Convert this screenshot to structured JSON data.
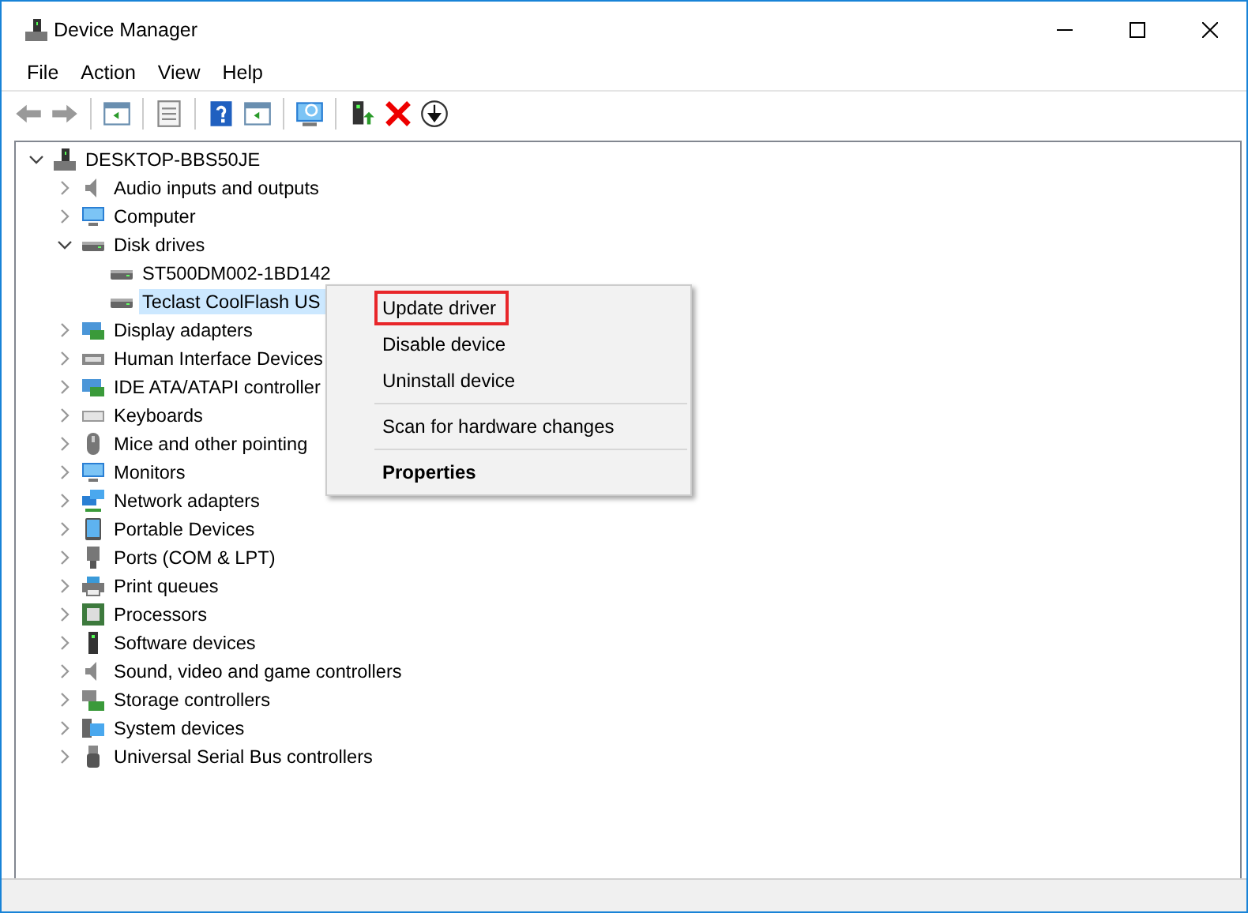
{
  "window": {
    "title": "Device Manager"
  },
  "menu_bar": [
    "File",
    "Action",
    "View",
    "Help"
  ],
  "tree": {
    "label": "DESKTOP-BBS50JE",
    "expanded": true,
    "selected": false,
    "children": [
      {
        "label": "Audio inputs and outputs",
        "expanded": false,
        "selected": false
      },
      {
        "label": "Computer",
        "expanded": false,
        "selected": false
      },
      {
        "label": "Disk drives",
        "expanded": true,
        "selected": false,
        "children": [
          {
            "label": "ST500DM002-1BD142",
            "selected": false
          },
          {
            "label": "Teclast CoolFlash US",
            "selected": true
          }
        ]
      },
      {
        "label": "Display adapters",
        "expanded": false,
        "selected": false
      },
      {
        "label": "Human Interface Devices",
        "expanded": false,
        "selected": false
      },
      {
        "label": "IDE ATA/ATAPI controller",
        "expanded": false,
        "selected": false
      },
      {
        "label": "Keyboards",
        "expanded": false,
        "selected": false
      },
      {
        "label": "Mice and other pointing",
        "expanded": false,
        "selected": false
      },
      {
        "label": "Monitors",
        "expanded": false,
        "selected": false
      },
      {
        "label": "Network adapters",
        "expanded": false,
        "selected": false
      },
      {
        "label": "Portable Devices",
        "expanded": false,
        "selected": false
      },
      {
        "label": "Ports (COM & LPT)",
        "expanded": false,
        "selected": false
      },
      {
        "label": "Print queues",
        "expanded": false,
        "selected": false
      },
      {
        "label": "Processors",
        "expanded": false,
        "selected": false
      },
      {
        "label": "Software devices",
        "expanded": false,
        "selected": false
      },
      {
        "label": "Sound, video and game controllers",
        "expanded": false,
        "selected": false
      },
      {
        "label": "Storage controllers",
        "expanded": false,
        "selected": false
      },
      {
        "label": "System devices",
        "expanded": false,
        "selected": false
      },
      {
        "label": "Universal Serial Bus controllers",
        "expanded": false,
        "selected": false
      }
    ]
  },
  "context_menu": [
    {
      "label": "Update driver",
      "highlighted": true,
      "default": false,
      "separator_before": false
    },
    {
      "label": "Disable device",
      "highlighted": false,
      "default": false,
      "separator_before": false
    },
    {
      "label": "Uninstall device",
      "highlighted": false,
      "default": false,
      "separator_before": false
    },
    {
      "label": "Scan for hardware changes",
      "highlighted": false,
      "default": false,
      "separator_before": true
    },
    {
      "label": "Properties",
      "highlighted": false,
      "default": true,
      "separator_before": true
    }
  ]
}
